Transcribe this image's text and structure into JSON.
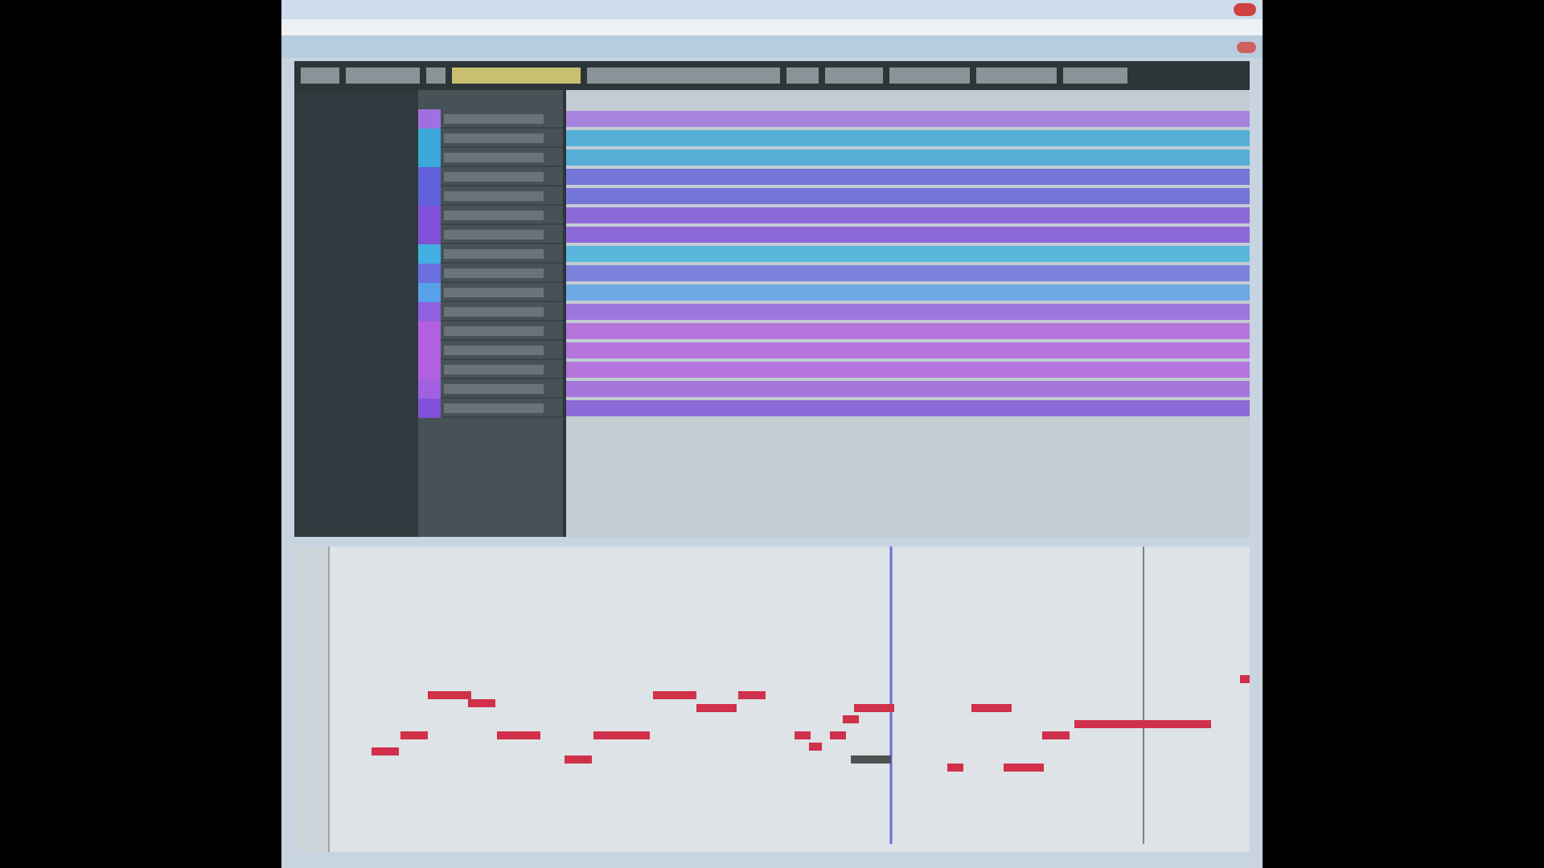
{
  "tracks": [
    {
      "color": "#a070e0"
    },
    {
      "color": "#3aa8d8"
    },
    {
      "color": "#3aa8d8"
    },
    {
      "color": "#6060d8"
    },
    {
      "color": "#6060d8"
    },
    {
      "color": "#8050d8"
    },
    {
      "color": "#8050d8"
    },
    {
      "color": "#40b0e0"
    },
    {
      "color": "#6a70e0"
    },
    {
      "color": "#58a0e8"
    },
    {
      "color": "#9060e0"
    },
    {
      "color": "#b060e0"
    },
    {
      "color": "#b060e0"
    },
    {
      "color": "#b060e0"
    },
    {
      "color": "#a060e0"
    },
    {
      "color": "#8050d8"
    }
  ]
}
